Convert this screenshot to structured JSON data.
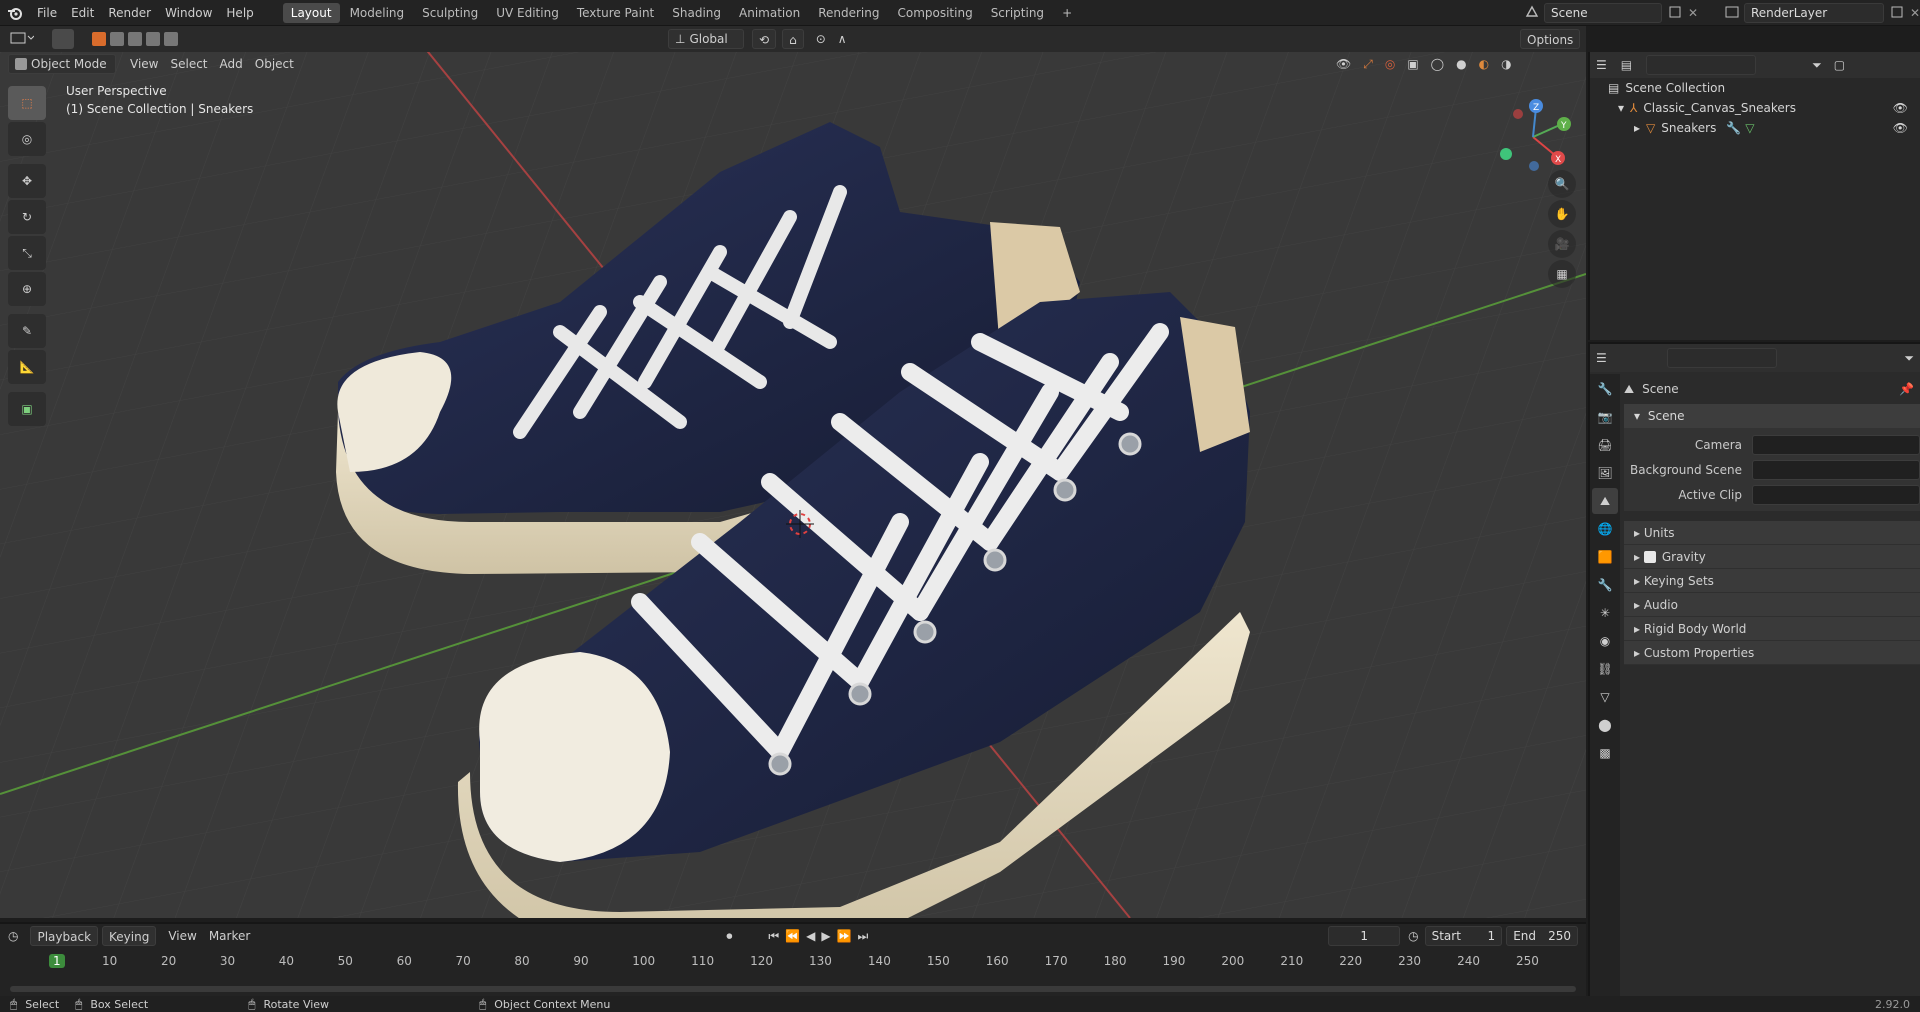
{
  "topbar": {
    "menus": [
      "File",
      "Edit",
      "Render",
      "Window",
      "Help"
    ],
    "workspaces": [
      "Layout",
      "Modeling",
      "Sculpting",
      "UV Editing",
      "Texture Paint",
      "Shading",
      "Animation",
      "Rendering",
      "Compositing",
      "Scripting"
    ],
    "active_workspace": "Layout",
    "add_tab": "+",
    "scene_name": "Scene",
    "view_layer": "RenderLayer"
  },
  "viewport_header": {
    "mode": "Object Mode",
    "menus": [
      "View",
      "Select",
      "Add",
      "Object"
    ],
    "transform_orientation": "Global",
    "options_label": "Options"
  },
  "viewport": {
    "view_name": "User Perspective",
    "collection_info": "(1) Scene Collection | Sneakers",
    "colors": {
      "background": "#393939",
      "x_axis": "#c43c3c",
      "y_axis": "#5fa83c",
      "canvas_dark": "#1f2644",
      "sole": "#e6dcc3",
      "lace": "#ececec"
    }
  },
  "toolbar": {
    "tools": [
      "select-box-icon",
      "cursor-icon",
      "move-icon",
      "rotate-icon",
      "scale-icon",
      "transform-icon",
      "annotate-icon",
      "measure-icon",
      "add-cube-icon"
    ]
  },
  "outliner": {
    "search_placeholder": "",
    "items": [
      {
        "label": "Scene Collection",
        "level": 0
      },
      {
        "label": "Classic_Canvas_Sneakers",
        "level": 1
      },
      {
        "label": "Sneakers",
        "level": 2
      }
    ]
  },
  "properties": {
    "context": "Scene",
    "panel_title": "Scene",
    "fields": [
      {
        "label": "Camera"
      },
      {
        "label": "Background Scene"
      },
      {
        "label": "Active Clip"
      }
    ],
    "subpanels": [
      "Units",
      "Gravity",
      "Keying Sets",
      "Audio",
      "Rigid Body World",
      "Custom Properties"
    ],
    "gravity_enabled": true
  },
  "timeline": {
    "menus": [
      "Playback",
      "Keying",
      "View",
      "Marker"
    ],
    "current_frame": "1",
    "start_label": "Start",
    "start": "1",
    "end_label": "End",
    "end": "250",
    "ticks": [
      "1",
      "10",
      "20",
      "30",
      "40",
      "50",
      "60",
      "70",
      "80",
      "90",
      "100",
      "110",
      "120",
      "130",
      "140",
      "150",
      "160",
      "170",
      "180",
      "190",
      "200",
      "210",
      "220",
      "230",
      "240",
      "250"
    ]
  },
  "statusbar": {
    "items": [
      "Select",
      "Box Select",
      "Rotate View",
      "Object Context Menu"
    ],
    "version": "2.92.0"
  }
}
